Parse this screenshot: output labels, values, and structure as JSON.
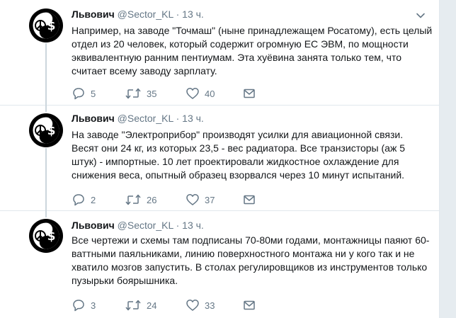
{
  "tweets": [
    {
      "name": "Львович",
      "handle": "@Sector_KL",
      "dot": "·",
      "time": "13 ч.",
      "text": "Например, на заводе \"Точмаш\" (ныне принадлежащем Росатому), есть целый отдел из 20 человек, который содержит огромную ЕС ЭВМ, по мощности эквивалентную ранним пентиумам. Эта хуёвина занята только тем, что считает всему заводу зарплату.",
      "replies": "5",
      "retweets": "35",
      "likes": "40"
    },
    {
      "name": "Львович",
      "handle": "@Sector_KL",
      "dot": "·",
      "time": "13 ч.",
      "text": "На заводе \"Электроприбор\" производят усилки для авиационной связи. Весят они 24 кг, из которых 23,5 - вес радиатора. Все транзисторы (аж 5 штук) - импортные. 10 лет проектировали жидкостное охлаждение для снижения веса, опытный образец взорвался через 10 минут испытаний.",
      "replies": "2",
      "retweets": "26",
      "likes": "37"
    },
    {
      "name": "Львович",
      "handle": "@Sector_KL",
      "dot": "·",
      "time": "13 ч.",
      "text": "Все чертежи и схемы там подписаны 70-80ми годами, монтажницы паяют 60-ваттными паяльниками, линию поверхностного монтажа ни у кого так и не хватило мозгов запустить. В столах регулировщиков из инструментов только пузырьки боярышника.",
      "replies": "3",
      "retweets": "24",
      "likes": "33"
    }
  ],
  "icons": {
    "avatar": "peace-dollar-avatar-icon",
    "caret": "chevron-down-icon",
    "reply": "reply-icon",
    "retweet": "retweet-icon",
    "like": "heart-icon",
    "dm": "envelope-icon"
  },
  "colors": {
    "text": "#14171a",
    "secondary": "#657786",
    "border": "#e1e8ed",
    "thread_line": "#ccd6dd",
    "page_bg": "#e6ecf0"
  }
}
